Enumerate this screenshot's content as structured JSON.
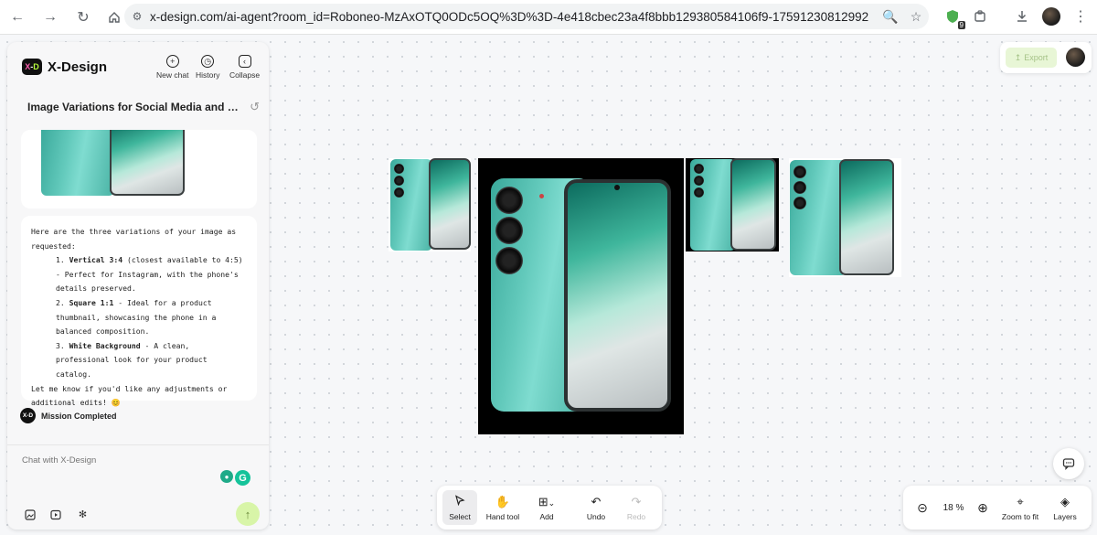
{
  "browser": {
    "url": "x-design.com/ai-agent?room_id=Roboneo-MzAxOTQ0ODc5OQ%3D%3D-4e418cbec23a4f8bbb129380584106f9-17591230812992",
    "extension_badge": "9"
  },
  "panel": {
    "brand": "X-Design",
    "logo_text": "X-D",
    "header_buttons": {
      "new_chat": "New chat",
      "history": "History",
      "collapse": "Collapse"
    },
    "chat_title": "Image Variations for Social Media and Cat...",
    "message": {
      "intro": "Here are the three variations of your image as requested:",
      "items": [
        {
          "index": "1.",
          "title": "Vertical 3:4",
          "rest": " (closest available to 4:5) - Perfect for Instagram, with the phone's details preserved."
        },
        {
          "index": "2.",
          "title": "Square 1:1",
          "rest": " - Ideal for a product thumbnail, showcasing the phone in a balanced composition."
        },
        {
          "index": "3.",
          "title": "White Background",
          "rest": " - A clean, professional look for your product catalog."
        }
      ],
      "outro": "Let me know if you'd like any adjustments or additional edits! 😊"
    },
    "mission_status": "Mission Completed",
    "chat_placeholder": "Chat with X-Design"
  },
  "export_label": "Export",
  "toolbar": {
    "select": "Select",
    "hand_tool": "Hand tool",
    "add": "Add",
    "undo": "Undo",
    "redo": "Redo"
  },
  "zoom": {
    "value": "18",
    "unit": "%",
    "zoom_to_fit": "Zoom to fit",
    "layers": "Layers"
  },
  "colors": {
    "accent_green": "#b6ff3b",
    "phone_teal": "#62c9bb"
  }
}
